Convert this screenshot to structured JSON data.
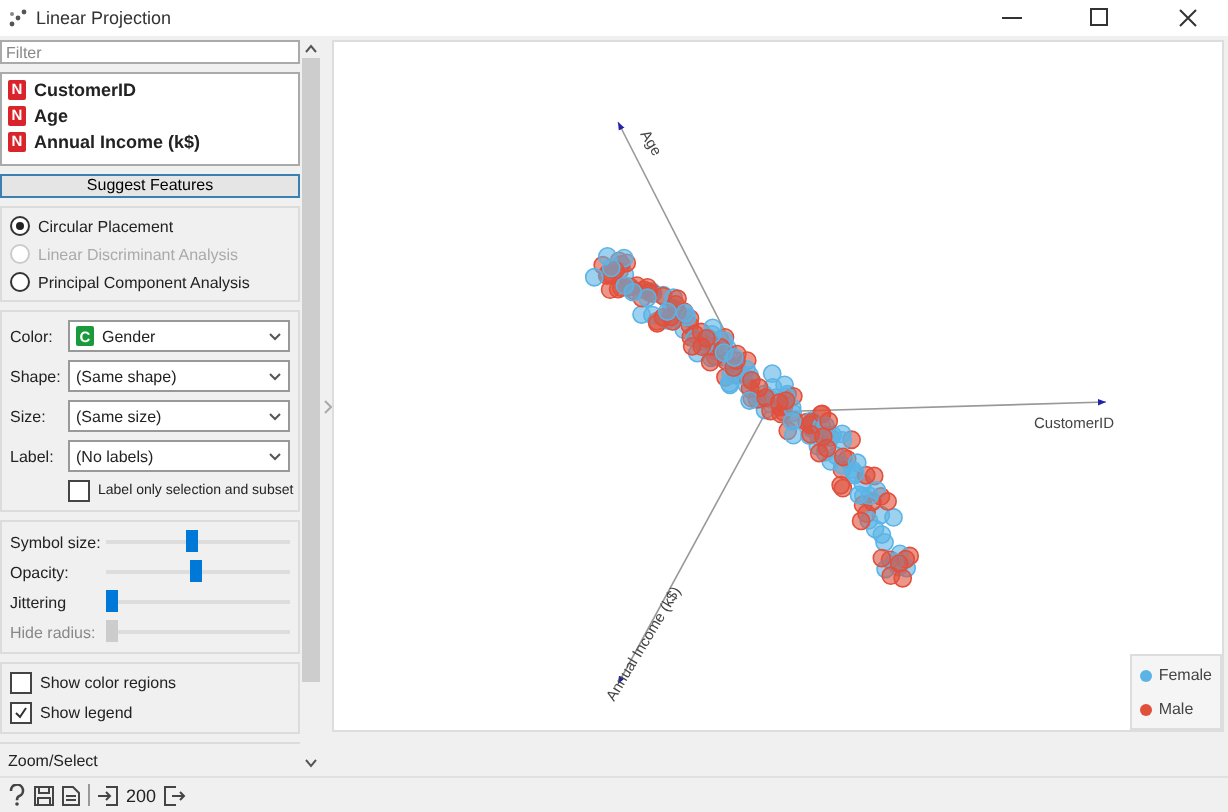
{
  "window": {
    "title": "Linear Projection"
  },
  "filter": {
    "placeholder": "Filter"
  },
  "features": [
    {
      "badge": "N",
      "name": "CustomerID"
    },
    {
      "badge": "N",
      "name": "Age"
    },
    {
      "badge": "N",
      "name": "Annual Income (k$)"
    }
  ],
  "suggest_button": "Suggest Features",
  "placement": [
    {
      "label": "Circular Placement",
      "selected": true,
      "disabled": false
    },
    {
      "label": "Linear Discriminant Analysis",
      "selected": false,
      "disabled": true
    },
    {
      "label": "Principal Component Analysis",
      "selected": false,
      "disabled": false
    }
  ],
  "attributes": [
    {
      "label": "Color:",
      "badge": "C",
      "value": "Gender"
    },
    {
      "label": "Shape:",
      "value": "(Same shape)"
    },
    {
      "label": "Size:",
      "value": "(Same size)"
    },
    {
      "label": "Label:",
      "value": "(No labels)"
    }
  ],
  "label_only_selection": {
    "label": "Label only selection and subset",
    "checked": false
  },
  "sliders": [
    {
      "label": "Symbol size:",
      "level": 0.47,
      "disabled": false
    },
    {
      "label": "Opacity:",
      "level": 0.49,
      "disabled": false
    },
    {
      "label": "Jittering",
      "level": 0,
      "disabled": false
    },
    {
      "label": "Hide radius:",
      "level": 0,
      "disabled": true
    }
  ],
  "options": [
    {
      "label": "Show color regions",
      "checked": false
    },
    {
      "label": "Show legend",
      "checked": true
    }
  ],
  "zoom_select": {
    "title": "Zoom/Select"
  },
  "plot": {
    "axes": [
      {
        "label": "Age"
      },
      {
        "label": "CustomerID"
      },
      {
        "label": "Annual Income (k$)"
      }
    ],
    "legend": [
      {
        "label": "Female",
        "color": "#5ab4e6"
      },
      {
        "label": "Male",
        "color": "#e0503c"
      }
    ],
    "show_legend": true
  },
  "status_bar": {
    "count": "200"
  }
}
